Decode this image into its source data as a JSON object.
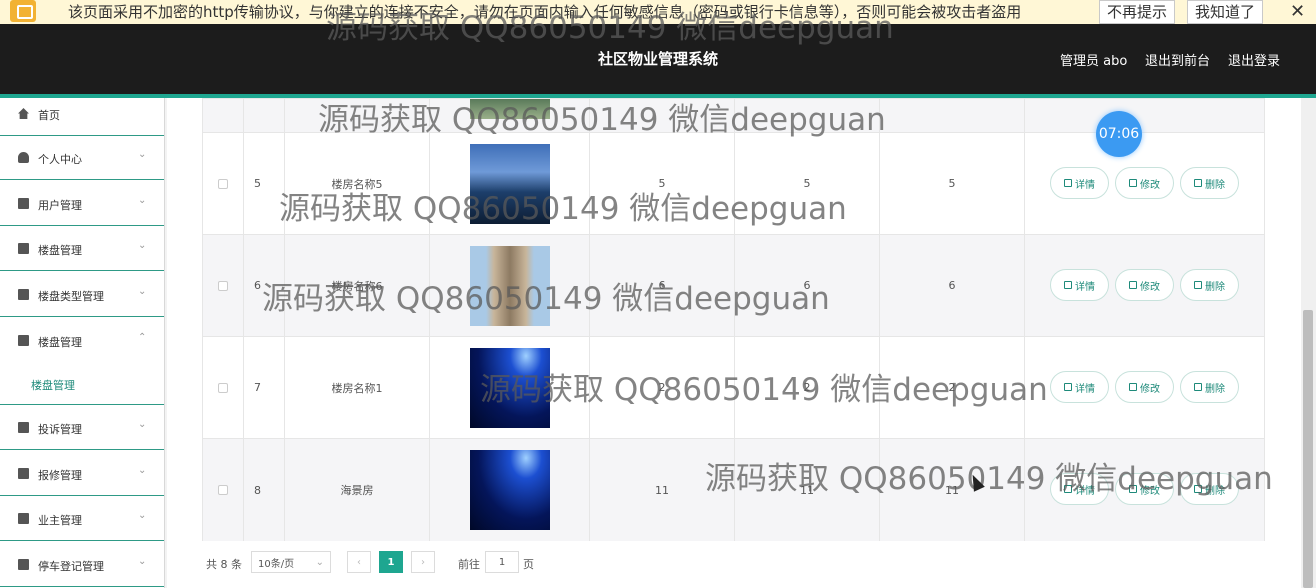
{
  "warning": {
    "text": "该页面采用不加密的http传输协议，与你建立的连接不安全，请勿在页面内输入任何敏感信息（密码或银行卡信息等），否则可能会被攻击者盗用",
    "btn_no_remind": "不再提示",
    "btn_got_it": "我知道了",
    "close": "✕"
  },
  "header": {
    "title": "社区物业管理系统",
    "admin": "管理员 abo",
    "to_front": "退出到前台",
    "logout": "退出登录"
  },
  "sidebar": {
    "items": [
      {
        "label": "首页",
        "icon": "home-icon"
      },
      {
        "label": "个人中心",
        "icon": "user-icon"
      },
      {
        "label": "用户管理",
        "icon": "file-icon"
      },
      {
        "label": "楼盘管理",
        "icon": "briefcase-icon"
      },
      {
        "label": "楼盘类型管理",
        "icon": "bar-chart-icon"
      },
      {
        "label": "楼盘管理",
        "icon": "clipboard-icon"
      },
      {
        "label": "投诉管理",
        "icon": "chart-icon"
      },
      {
        "label": "报修管理",
        "icon": "message-icon"
      },
      {
        "label": "业主管理",
        "icon": "grid-icon"
      },
      {
        "label": "停车登记管理",
        "icon": "comment-icon"
      }
    ],
    "sub_item": "楼盘管理"
  },
  "table": {
    "rows": [
      {
        "index": "5",
        "name": "楼房名称5",
        "c1": "5",
        "c2": "5",
        "c3": "5",
        "img": "city-towers"
      },
      {
        "index": "6",
        "name": "楼房名称6",
        "c1": "6",
        "c2": "6",
        "c3": "6",
        "img": "highrise"
      },
      {
        "index": "7",
        "name": "楼房名称1",
        "c1": "2",
        "c2": "2",
        "c3": "2",
        "img": "blue-stage"
      },
      {
        "index": "8",
        "name": "海景房",
        "c1": "11",
        "c2": "11",
        "c3": "11",
        "img": "blue-stage"
      }
    ],
    "actions": {
      "detail": "详情",
      "edit": "修改",
      "delete": "删除"
    }
  },
  "timer": "07:06",
  "pager": {
    "total": "共 8 条",
    "page_size": "10条/页",
    "current": "1",
    "goto_label": "前往",
    "goto_value": "1",
    "page_suffix": "页"
  },
  "watermark": "源码获取 QQ86050149 微信deepguan",
  "colors": {
    "accent": "#1ea690",
    "header_bg": "#1c1c1c",
    "timer": "#3b9af2"
  }
}
